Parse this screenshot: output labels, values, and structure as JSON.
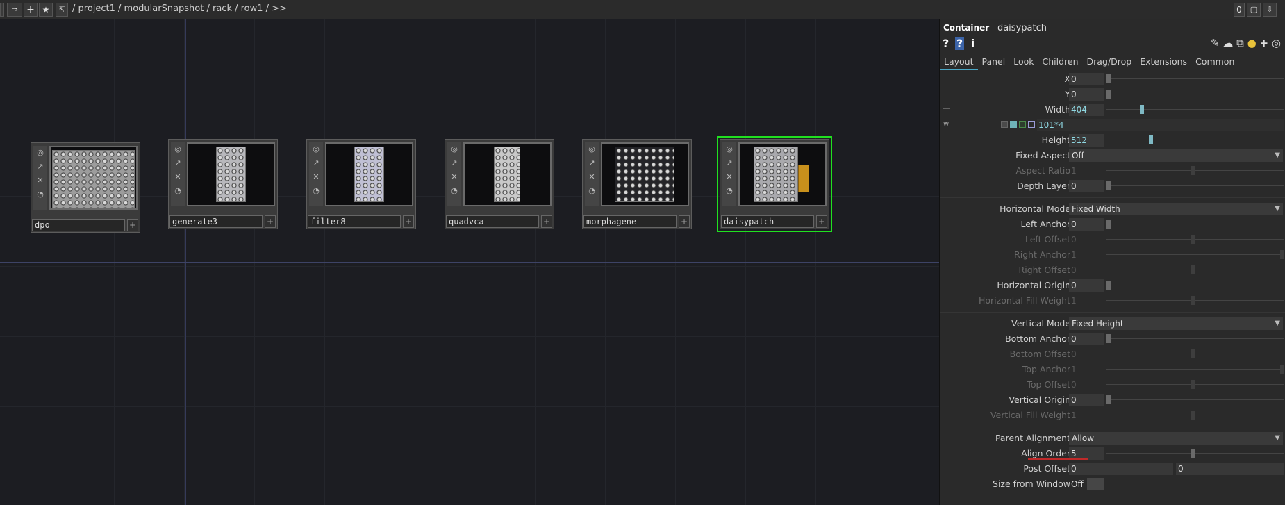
{
  "toolbar": {
    "back": "⇐",
    "forward": "⇒",
    "add": "+",
    "star": "★",
    "go": "↸",
    "path": "/ project1 / modularSnapshot / rack / row1 / >>",
    "counter": "0"
  },
  "nodes": [
    {
      "name": "dpo"
    },
    {
      "name": "generate3"
    },
    {
      "name": "filter8"
    },
    {
      "name": "quadvca"
    },
    {
      "name": "morphagene"
    },
    {
      "name": "daisypatch"
    }
  ],
  "node_side_icons": [
    "◎",
    "↗",
    "✕",
    "◔"
  ],
  "panel": {
    "type": "Container",
    "name": "daisypatch",
    "tabs": [
      "Layout",
      "Panel",
      "Look",
      "Children",
      "Drag/Drop",
      "Extensions",
      "Common"
    ],
    "active_tab": "Layout",
    "params": {
      "x": {
        "label": "X",
        "value": "0"
      },
      "y": {
        "label": "Y",
        "value": "0"
      },
      "width": {
        "label": "Width",
        "value": "404"
      },
      "width_expr": {
        "prefix": "w",
        "value": "101*4"
      },
      "height": {
        "label": "Height",
        "value": "512"
      },
      "fixed_aspect": {
        "label": "Fixed Aspect",
        "value": "Off"
      },
      "aspect_ratio": {
        "label": "Aspect Ratio",
        "value": "1"
      },
      "depth_layer": {
        "label": "Depth Layer",
        "value": "0"
      },
      "horizontal_mode": {
        "label": "Horizontal Mode",
        "value": "Fixed Width"
      },
      "left_anchor": {
        "label": "Left Anchor",
        "value": "0"
      },
      "left_offset": {
        "label": "Left Offset",
        "value": "0"
      },
      "right_anchor": {
        "label": "Right Anchor",
        "value": "1"
      },
      "right_offset": {
        "label": "Right Offset",
        "value": "0"
      },
      "horizontal_origin": {
        "label": "Horizontal Origin",
        "value": "0"
      },
      "horizontal_fill_weight": {
        "label": "Horizontal Fill Weight",
        "value": "1"
      },
      "vertical_mode": {
        "label": "Vertical Mode",
        "value": "Fixed Height"
      },
      "bottom_anchor": {
        "label": "Bottom Anchor",
        "value": "0"
      },
      "bottom_offset": {
        "label": "Bottom Offset",
        "value": "0"
      },
      "top_anchor": {
        "label": "Top Anchor",
        "value": "1"
      },
      "top_offset": {
        "label": "Top Offset",
        "value": "0"
      },
      "vertical_origin": {
        "label": "Vertical Origin",
        "value": "0"
      },
      "vertical_fill_weight": {
        "label": "Vertical Fill Weight",
        "value": "1"
      },
      "parent_alignment": {
        "label": "Parent Alignment",
        "value": "Allow"
      },
      "align_order": {
        "label": "Align Order",
        "value": "5"
      },
      "post_offset": {
        "label": "Post Offset",
        "value": "0",
        "value2": "0"
      },
      "size_from_window": {
        "label": "Size from Window",
        "value": "Off"
      }
    }
  },
  "colors": {
    "selection": "#20e020",
    "accent": "#4aa8c6",
    "canvas": "#1c1d22",
    "panel": "#2a2a2a"
  }
}
